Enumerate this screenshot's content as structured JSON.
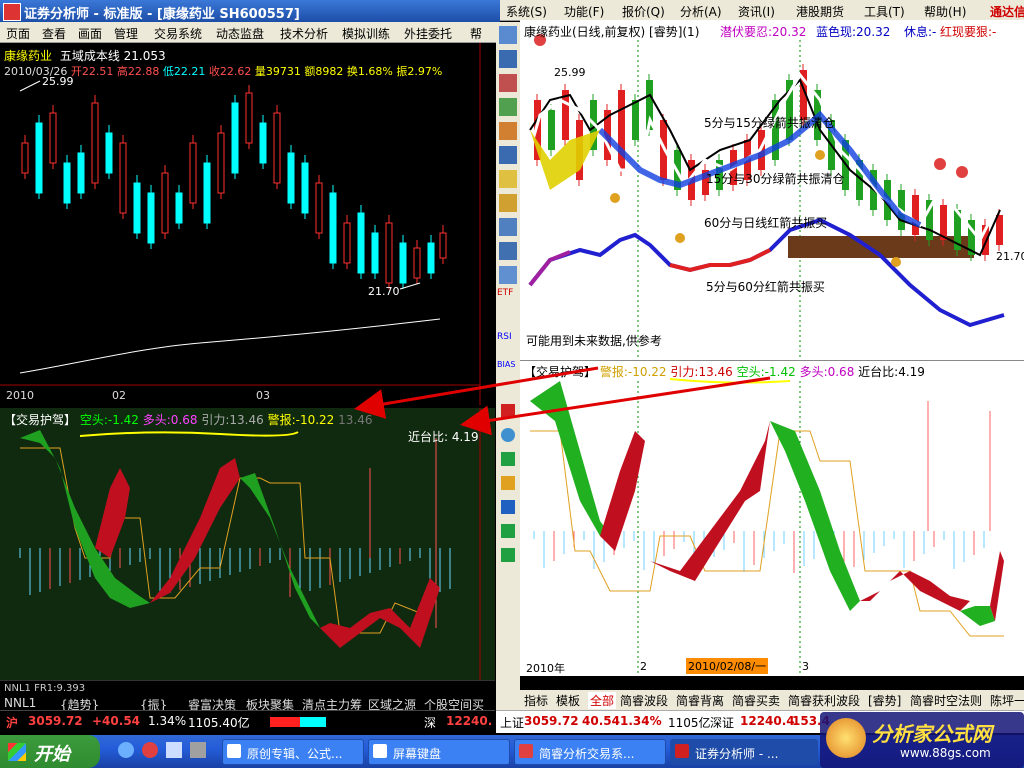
{
  "left_window": {
    "title": "证券分析师 - 标准版 - [康缘药业 SH600557]",
    "menu": [
      "页面",
      "查看",
      "画面",
      "管理",
      "交易系统",
      "动态监盘",
      "技术分析",
      "模拟训练",
      "外挂委托",
      "帮"
    ],
    "chart_header": {
      "stock": "康缘药业",
      "indicator": "五域成本线 21.053",
      "date": "2010/03/26",
      "open": "开22.51",
      "high": "高22.88",
      "low": "低22.21",
      "close": "收22.62",
      "volume": "量39731",
      "amount": "额8982",
      "turnover": "换1.68%",
      "amplitude": "振2.97%"
    },
    "price_high_label": "25.99",
    "price_low_label": "21.70",
    "x_labels": [
      "2010",
      "02",
      "03"
    ],
    "indicator_header": {
      "name": "【交易护驾】",
      "kong": "空头:-1.42",
      "duo": "多头:0.68",
      "yinli": "引力:13.46",
      "jingbao": "警报:-10.22",
      "extra": "13.46"
    },
    "jintaibi": "近台比: 4.19",
    "bottom_info": "NNL1  FR1:9.393",
    "tabs": [
      "NNL1",
      "{趋势}",
      "{振}",
      "睿富决策",
      "板块聚集",
      "清点主力筹",
      "区域之源",
      "个股空间买"
    ],
    "status": {
      "market": "沪",
      "index": "3059.72",
      "change": "+40.54",
      "pct": "1.34%",
      "amount": "1105.40亿",
      "market2": "深",
      "index2": "12240."
    }
  },
  "right_window": {
    "menu": [
      "系统(S)",
      "功能(F)",
      "报价(Q)",
      "分析(A)",
      "资讯(I)",
      "港股期货",
      "工具(T)",
      "帮助(H)",
      "通达信"
    ],
    "chart_title": "康缘药业(日线,前复权)",
    "title_extra": "[睿势](1)",
    "qianfu": "潜伏要忍:20.32",
    "lanse": "蓝色现:20.32",
    "xiuxi": "休息:-",
    "hongxian": "红现要狠:-",
    "price_high_label": "25.99",
    "price_right_label": "21.70",
    "annotations": [
      "5分与15分绿箭共振清仓",
      "15分与30分绿箭共振清仓",
      "60分与日线红箭共振买",
      "5分与60分红箭共振买"
    ],
    "disclaimer": "可能用到未来数据,供参考",
    "indicator_header": {
      "name": "【交易护驾】",
      "jingbao": "警报:-10.22",
      "yinli": "引力:13.46",
      "kong": "空头:-1.42",
      "duo": "多头:0.68",
      "jintai": "近台比:4.19"
    },
    "x_labels": [
      "2010年",
      "2",
      "2010/02/08/一",
      "3"
    ],
    "tabs": [
      "指标",
      "模板",
      "全部",
      "简睿波段",
      "简睿背离",
      "简睿买卖",
      "简睿获利波段",
      "[睿势]",
      "简睿时空法则",
      "陈坪一"
    ],
    "status": {
      "sh": "上证",
      "sh_val": "3059.72",
      "sh_chg": "40.54",
      "sh_pct": "1.34%",
      "sh_amt": "1105亿",
      "sz": "深证",
      "sz_val": "12240.4",
      "sz_extra": "153.4"
    },
    "side_labels": [
      "RSI",
      "BIAS",
      "ETF"
    ]
  },
  "taskbar": {
    "start": "开始",
    "tasks": [
      "原创专辑、公式...",
      "屏幕键盘",
      "简睿分析交易系...",
      "证券分析师 - ..."
    ]
  },
  "watermark": {
    "brand": "分析家公式网",
    "url": "www.88gs.com"
  },
  "colors": {
    "up": "#ff3030",
    "down": "#00ffff",
    "green_band": "#20c020",
    "red_band": "#d00020",
    "yellow_line": "#ffff00",
    "orange_line": "#ff9900"
  }
}
